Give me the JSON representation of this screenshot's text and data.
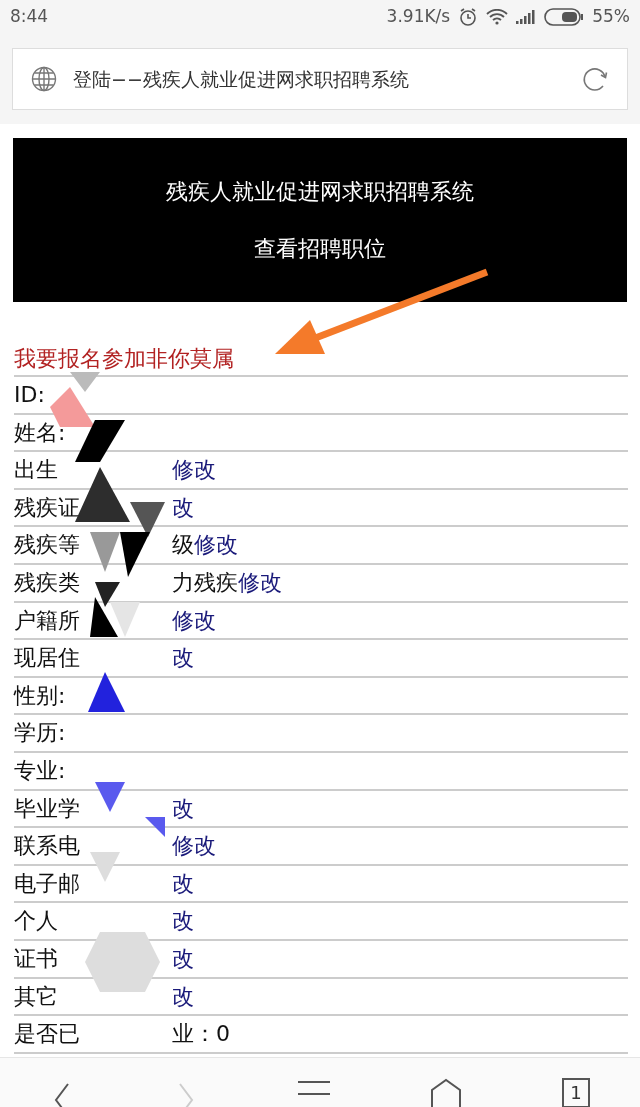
{
  "status_bar": {
    "time": "8:44",
    "speed": "3.91K/s",
    "battery": "55%"
  },
  "address_bar": {
    "title": "登陆−−残疾人就业促进网求职招聘系统"
  },
  "header": {
    "title": "残疾人就业促进网求职招聘系统",
    "link": "查看招聘职位"
  },
  "signup_link": "我要报名参加非你莫属",
  "rows": [
    {
      "label": "ID:"
    },
    {
      "label": "姓名:"
    },
    {
      "label": "出生",
      "link": "修改"
    },
    {
      "label": "残疾证",
      "link": "改"
    },
    {
      "label": "残疾等",
      "value": "级",
      "link": "修改"
    },
    {
      "label": "残疾类",
      "value": "力残疾",
      "link": "修改"
    },
    {
      "label": "户籍所",
      "link": "修改"
    },
    {
      "label": "现居住",
      "link": "改"
    },
    {
      "label": "性别:"
    },
    {
      "label": "学历:"
    },
    {
      "label": "专业:"
    },
    {
      "label": "毕业学",
      "link": "改"
    },
    {
      "label": "联系电",
      "link": "修改"
    },
    {
      "label": "电子邮",
      "link": "改"
    },
    {
      "label": "个人",
      "link": "改"
    },
    {
      "label": "证书",
      "link": "改"
    },
    {
      "label": "其它",
      "link": "改"
    },
    {
      "label": "是否已",
      "value": "业：0"
    }
  ],
  "bottom_nav": {
    "tabs_count": "1"
  }
}
